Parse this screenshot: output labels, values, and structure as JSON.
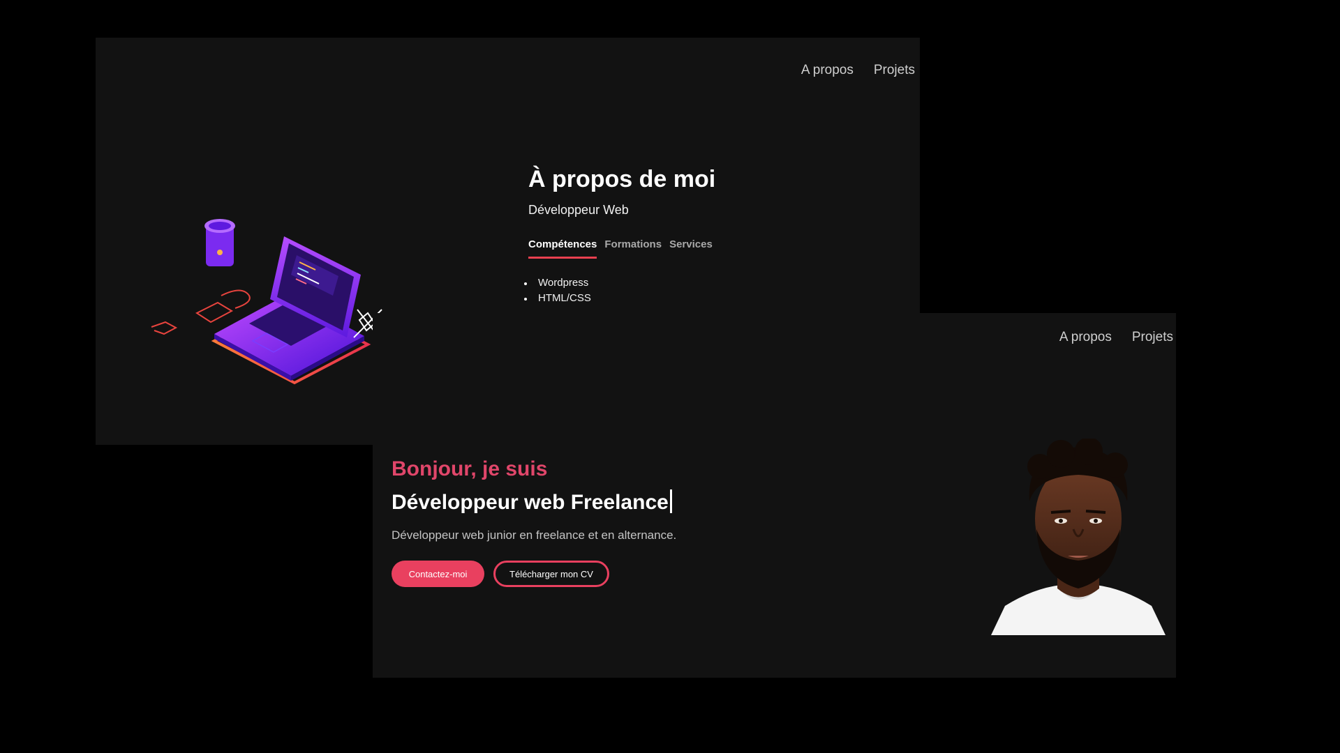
{
  "about": {
    "nav": {
      "about": "A propos",
      "projects": "Projets"
    },
    "title": "À propos de moi",
    "subtitle": "Développeur Web",
    "tabs": [
      "Compétences",
      "Formations",
      "Services"
    ],
    "skills": [
      "Wordpress",
      "HTML/CSS"
    ]
  },
  "hero": {
    "nav": {
      "about": "A propos",
      "projects": "Projets"
    },
    "greeting": "Bonjour, je suis",
    "title": "Développeur web Freelance",
    "description": "Développeur web junior en freelance et en alternance.",
    "buttons": {
      "contact": "Contactez-moi",
      "cv": "Télécharger mon CV"
    }
  },
  "colors": {
    "background": "#000000",
    "panel": "#121212",
    "accent": "#e9405f",
    "greeting": "#e0466a"
  },
  "icons": [
    "laptop-illustration",
    "cup-illustration",
    "avatar-portrait"
  ]
}
